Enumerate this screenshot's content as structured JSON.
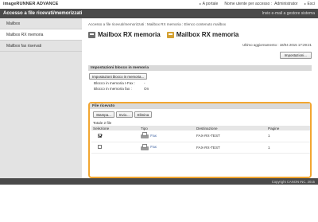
{
  "app": {
    "brand": "imageRUNNER ADVANCE",
    "portal_link": "A portale",
    "user_label": "Nome utente per accesso :",
    "user_value": "Administrator",
    "logout": "Esci"
  },
  "header": {
    "title": "Accesso a file ricevuti/memorizzati",
    "email_link": "Invio e-mail a gestore sistema"
  },
  "sidebar": {
    "items": [
      {
        "label": "Mailbox"
      },
      {
        "label": "Mailbox RX memoria"
      },
      {
        "label": "Mailbox fax riservati"
      }
    ]
  },
  "main": {
    "breadcrumb": "Accesso a file ricevuti/memorizzati : Mailbox RX memoria : Elenco contenuto mailbox",
    "title_1": "Mailbox RX memoria",
    "title_2": "Mailbox RX memoria",
    "updated": "Ultimo aggiornamento : 18/04 2015 17:29:21",
    "settings_button": "Impostazioni...",
    "memory": {
      "heading": "Impostazioni blocco in memoria",
      "button": "Impostazioni blocco in memoria...",
      "rows": [
        {
          "label": "Blocco in memoria I-Fax :",
          "value": "-"
        },
        {
          "label": "Blocco in memoria fax :",
          "value": "On"
        }
      ]
    },
    "received": {
      "heading": "File ricevuto",
      "buttons": {
        "print": "Stampa...",
        "send": "Invio...",
        "delete": "Elimina"
      },
      "total": "Totale 2 file",
      "columns": {
        "selection": "Selezione",
        "type": "Tipo",
        "destination": "Destinazione",
        "pages": "Pagine"
      },
      "rows": [
        {
          "checked": true,
          "type": "Fax",
          "destination": "FAX-RX-TEST",
          "pages": "1"
        },
        {
          "checked": false,
          "type": "Fax",
          "destination": "FAX-RX-TEST",
          "pages": "1"
        }
      ]
    }
  },
  "footer": {
    "copyright": "Copyright CANON INC. 2015"
  },
  "colors": {
    "header": "#4a4a4a",
    "highlight_border": "#f2a630",
    "sidebar": "#e3e3e3",
    "section_head": "#d9d9d9"
  }
}
